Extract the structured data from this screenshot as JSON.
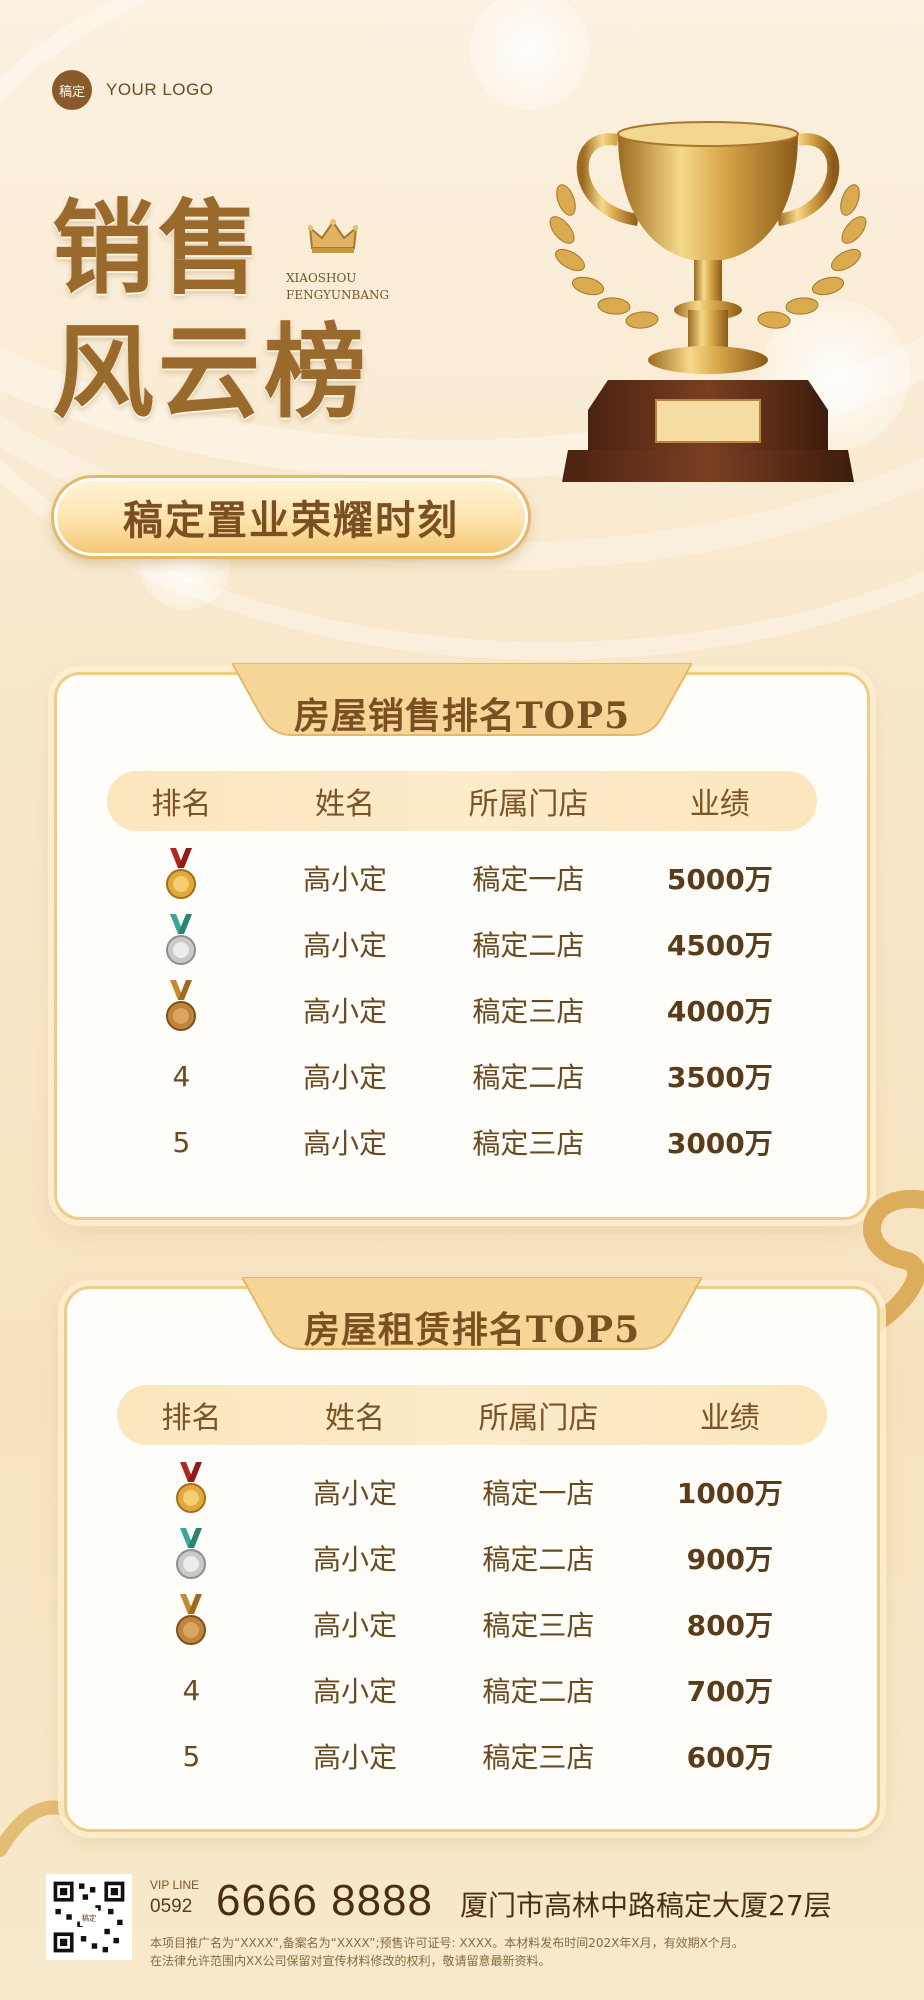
{
  "header": {
    "logo_badge": "稿定",
    "logo_text": "YOUR LOGO",
    "title_line1": "销售",
    "title_line2": "风云榜",
    "pinyin_line1": "XIAOSHOU",
    "pinyin_line2": "FENGYUNBANG",
    "slogan": "稿定置业荣耀时刻"
  },
  "sales": {
    "title": "房屋销售排名TOP5",
    "columns": [
      "排名",
      "姓名",
      "所属门店",
      "业绩"
    ],
    "rows": [
      {
        "rank": "",
        "medal": "gold-medal-icon",
        "name": "高小定",
        "store": "稿定一店",
        "value": "5000万"
      },
      {
        "rank": "",
        "medal": "silver-medal-icon",
        "name": "高小定",
        "store": "稿定二店",
        "value": "4500万"
      },
      {
        "rank": "",
        "medal": "bronze-medal-icon",
        "name": "高小定",
        "store": "稿定三店",
        "value": "4000万"
      },
      {
        "rank": "4",
        "medal": "",
        "name": "高小定",
        "store": "稿定二店",
        "value": "3500万"
      },
      {
        "rank": "5",
        "medal": "",
        "name": "高小定",
        "store": "稿定三店",
        "value": "3000万"
      }
    ]
  },
  "rental": {
    "title": "房屋租赁排名TOP5",
    "columns": [
      "排名",
      "姓名",
      "所属门店",
      "业绩"
    ],
    "rows": [
      {
        "rank": "",
        "medal": "gold-medal-icon",
        "name": "高小定",
        "store": "稿定一店",
        "value": "1000万"
      },
      {
        "rank": "",
        "medal": "silver-medal-icon",
        "name": "高小定",
        "store": "稿定二店",
        "value": "900万"
      },
      {
        "rank": "",
        "medal": "bronze-medal-icon",
        "name": "高小定",
        "store": "稿定三店",
        "value": "800万"
      },
      {
        "rank": "4",
        "medal": "",
        "name": "高小定",
        "store": "稿定二店",
        "value": "700万"
      },
      {
        "rank": "5",
        "medal": "",
        "name": "高小定",
        "store": "稿定三店",
        "value": "600万"
      }
    ]
  },
  "footer": {
    "vip_label": "VIP LINE",
    "area_code": "0592",
    "phone": "6666 8888",
    "address": "厦门市高林中路稿定大厦27层",
    "fine_print_1": "本项目推广名为“XXXX”,备案名为“XXXX”;预售许可证号: XXXX。本材料发布时间202X年X月，有效期X个月。",
    "fine_print_2": "在法律允许范围内XX公司保留对宣传材料修改的权利，敬请留意最新资料。",
    "qr_center": "稿定"
  },
  "colors": {
    "gold_dark": "#9a6a2c",
    "brown_text": "#6b4a1f",
    "panel_border": "#f0cd86",
    "background": "#f8e8cb"
  }
}
